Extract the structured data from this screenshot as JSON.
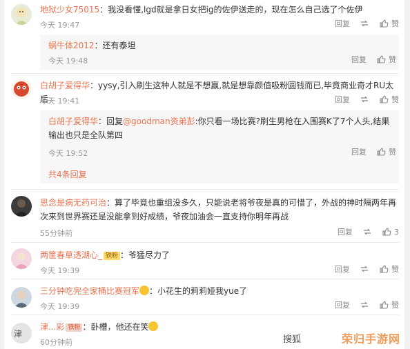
{
  "comments": [
    {
      "user": "地狱少女75015",
      "text": "：我没看懂,lgd就是拿日女把ig的佐伊送走的，现在怎么自己选了个佐伊",
      "time": "今天 19:47",
      "reply": "回复",
      "like": "赞",
      "replies": [
        {
          "user": "蜗牛体2012",
          "text": "：还有泰坦",
          "time": "今天 19:48",
          "reply": "回复",
          "like": "赞"
        }
      ]
    },
    {
      "user": "白胡子爱得华",
      "text": "：yysy,引入刷生这种人就是不想赢,就是想靠颜值吸粉圆钱而已,毕竟商业奇才RU太后",
      "time": "今天 19:41",
      "reply": "回复",
      "like": "赞",
      "replies": [
        {
          "user": "白胡子爱得华",
          "text": "：回复",
          "mention": "@goodman资弟彭",
          "text2": ":你只看一场比赛?刷生男枪在入围赛K了7个人头,结果",
          "text3": "输出也只是全队第四",
          "time": "今天 19:52",
          "reply": "回复",
          "like": "赞"
        }
      ],
      "more": "共4条回复"
    },
    {
      "user": "思念是病无药可治",
      "text": "：算了毕竟也重组没多久，只能说老将爷夜是真的可惜了，外战的神时隔两年再",
      "text2": "次来到世界赛还是没能拿到好成绩，爷夜加油会一直支持你明年再战",
      "time": "55分钟前",
      "reply": "回复",
      "like": "3"
    },
    {
      "user": "两筐春草透湖心_",
      "badge": "铁粉",
      "text": "：爷猛尽力了",
      "time": "今天 19:39",
      "reply": "回复",
      "like": "赞"
    },
    {
      "user": "三分钟吃完全家桶比赛冠军",
      "text": "：小花生的莉莉娅我yue了",
      "time": "今天 19:39",
      "reply": "回复",
      "like": "赞"
    },
    {
      "user": "津...彩",
      "badge": "铁粉",
      "text": "：卧槽，他还在笑",
      "time": "60分钟前"
    }
  ],
  "watermark": {
    "source": "搜狐",
    "site": "荣归手游网"
  },
  "colors": {
    "accent": "#eb7350",
    "muted": "#999999",
    "reply_bg": "#f7f7f7"
  }
}
